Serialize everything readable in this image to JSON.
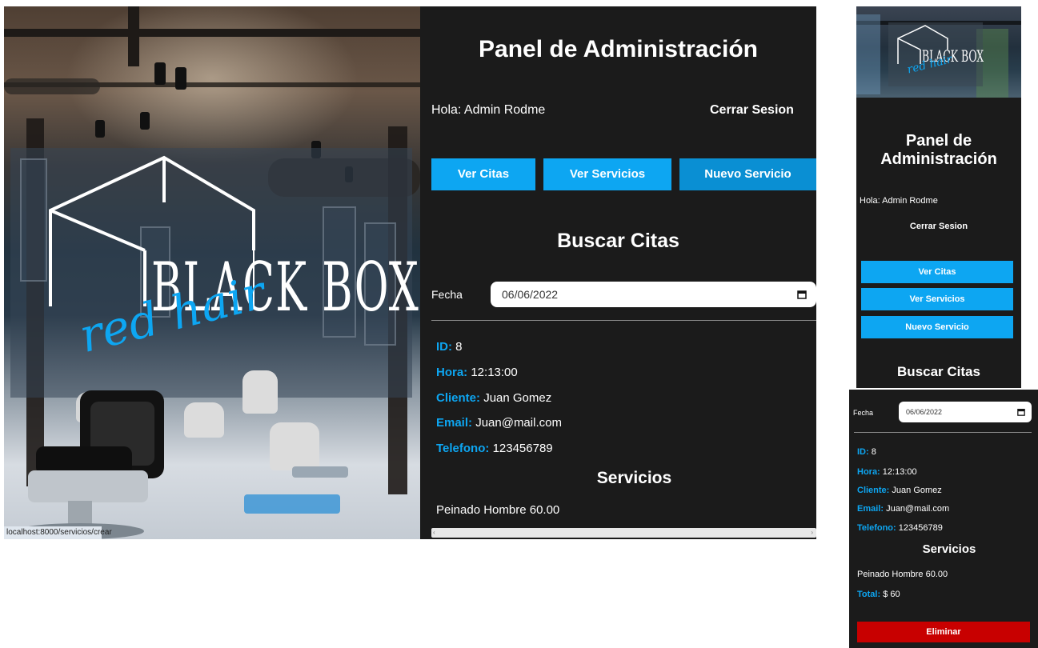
{
  "brand": {
    "name": "BLACK BOX",
    "script": "red hair"
  },
  "status_url": "localhost:8000/servicios/crear",
  "panel": {
    "title": "Panel de Administración",
    "greeting": "Hola: Admin Rodme",
    "logout": "Cerrar Sesion",
    "nav": [
      "Ver Citas",
      "Ver Servicios",
      "Nuevo Servicio"
    ],
    "search_title": "Buscar Citas",
    "date_label": "Fecha",
    "date_value": "06/06/2022"
  },
  "appointment": {
    "id_label": "ID:",
    "id": "8",
    "hour_label": "Hora:",
    "hour": "12:13:00",
    "client_label": "Cliente:",
    "client": "Juan Gomez",
    "email_label": "Email:",
    "email": "Juan@mail.com",
    "phone_label": "Telefono:",
    "phone": "123456789",
    "services_title": "Servicios",
    "service_line": "Peinado Hombre 60.00",
    "total_label": "Total:",
    "total": "$ 60",
    "delete_label": "Eliminar"
  },
  "mobile": {
    "title_line1": "Panel de",
    "title_line2": "Administración"
  },
  "colors": {
    "background": "#1b1b1b",
    "accent": "#0da6f2",
    "danger": "#c80000"
  }
}
